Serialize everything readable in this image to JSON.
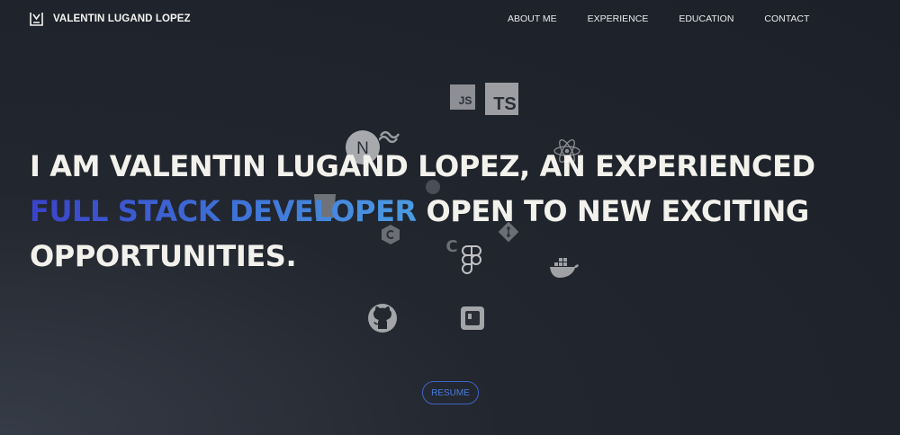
{
  "brand": {
    "name": "VALENTIN LUGAND LOPEZ",
    "logo_icon": "vl-monogram-icon"
  },
  "nav": {
    "links": [
      {
        "label": "ABOUT ME"
      },
      {
        "label": "EXPERIENCE"
      },
      {
        "label": "EDUCATION"
      },
      {
        "label": "CONTACT"
      }
    ]
  },
  "hero": {
    "line_prefix": "I AM VALENTIN LUGAND LOPEZ, AN EXPERIENCED",
    "highlight": "FULL STACK DEVELOPER",
    "line_suffix": " OPEN TO NEW EXCITING OPPORTUNITIES.",
    "highlight_colors": [
      "#3a43c9",
      "#4b9ce3"
    ]
  },
  "tech_icons": {
    "js_label": "JS",
    "ts_label": "TS",
    "nextjs_label": "N",
    "c_label": "C",
    "items": [
      "javascript-icon",
      "typescript-icon",
      "nextjs-icon",
      "tailwind-icon",
      "react-icon",
      "html5-icon",
      "graphql-icon",
      "csharp-icon",
      "git-icon",
      "c-icon",
      "figma-icon",
      "docker-icon",
      "github-icon",
      "jetbrains-icon"
    ]
  },
  "cta": {
    "resume_label": "RESUME",
    "accent": "#3e63c7"
  }
}
